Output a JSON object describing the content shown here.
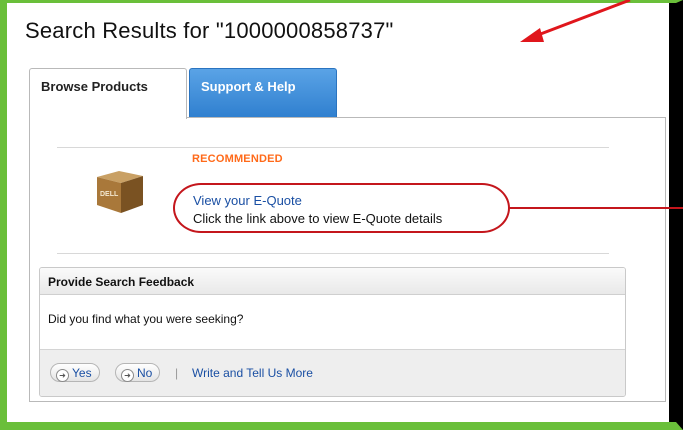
{
  "page": {
    "title": "Search Results for \"1000000858737\""
  },
  "tabs": [
    {
      "label": "Browse Products",
      "active": true
    },
    {
      "label": "Support & Help",
      "active": false
    }
  ],
  "recommended": {
    "badge": "RECOMMENDED",
    "icon_name": "dell-box-icon",
    "icon_text": "DELL",
    "link": "View your E-Quote",
    "description": "Click the link above to view E-Quote details"
  },
  "feedback": {
    "header": "Provide Search Feedback",
    "question": "Did you find what you were seeking?",
    "yes_label": "Yes",
    "no_label": "No",
    "separator": "|",
    "write_label": "Write and Tell Us More"
  },
  "colors": {
    "frame": "#6abf3a",
    "annotation": "#c4161c",
    "recommended": "#ff6a1a",
    "link": "#1a4fa3",
    "tab_active_bg": "#ffffff",
    "tab_inactive_bg": "#3b8ad8"
  }
}
